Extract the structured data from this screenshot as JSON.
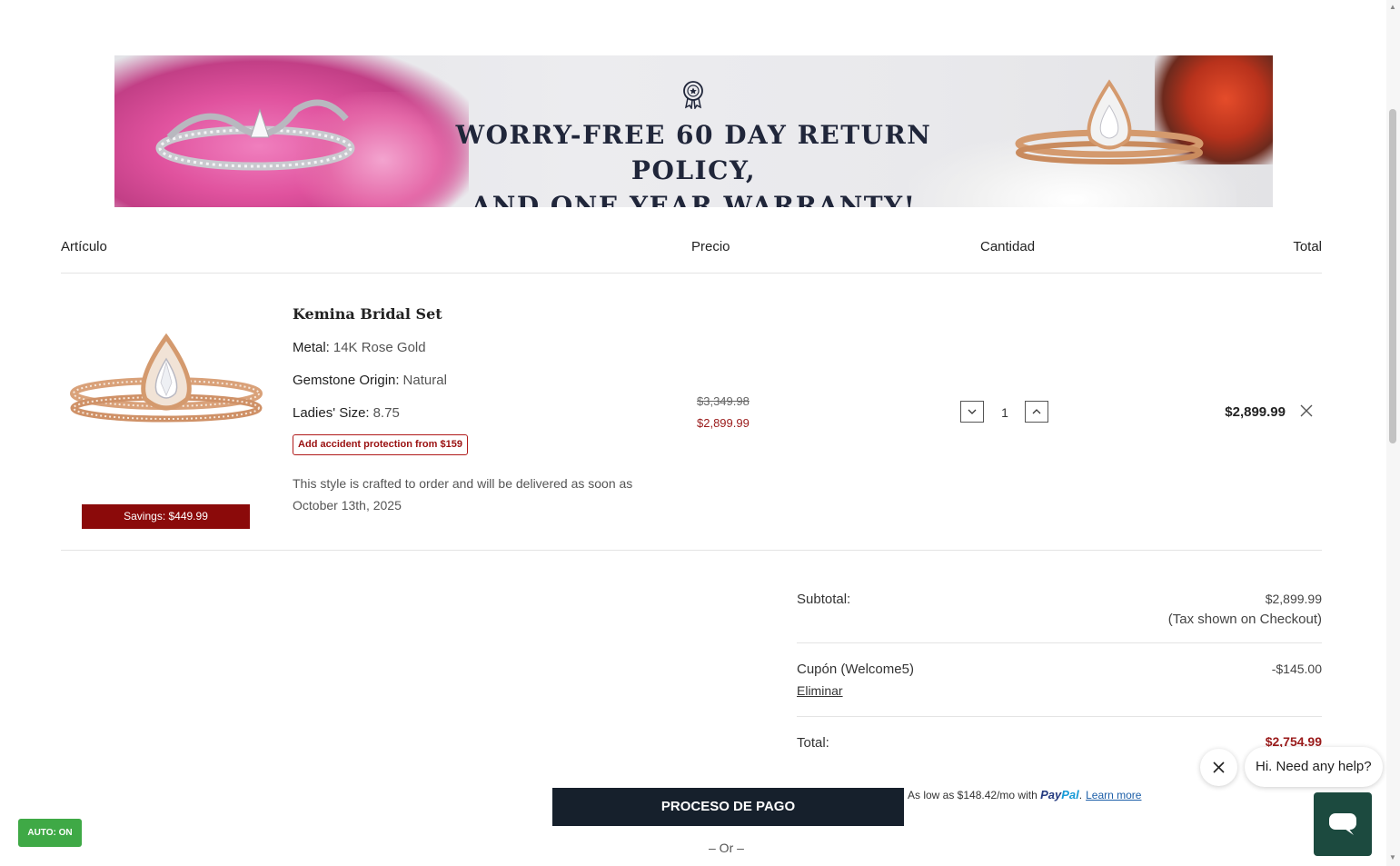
{
  "banner": {
    "line1": "WORRY-FREE 60 DAY RETURN POLICY,",
    "line2": "AND ONE YEAR WARRANTY!"
  },
  "table_header": {
    "item": "Artículo",
    "price": "Precio",
    "quantity": "Cantidad",
    "total": "Total"
  },
  "product": {
    "name": "Kemina Bridal Set",
    "attributes": [
      {
        "label": "Metal:",
        "value": "14K Rose Gold"
      },
      {
        "label": "Gemstone Origin:",
        "value": "Natural"
      },
      {
        "label": "Ladies' Size:",
        "value": "8.75"
      }
    ],
    "protection_label": "Add accident protection from $159",
    "delivery_note": "This style is crafted to order and will be delivered as soon as October 13th, 2025",
    "savings": "Savings: $449.99",
    "original_price": "$3,349.98",
    "sale_price": "$2,899.99",
    "quantity": "1",
    "line_total": "$2,899.99"
  },
  "summary": {
    "subtotal_label": "Subtotal:",
    "subtotal_value": "$2,899.99",
    "tax_note": "(Tax shown on Checkout)",
    "coupon_label": "Cupón (Welcome5)",
    "coupon_value": "-$145.00",
    "remove_coupon": "Eliminar",
    "total_label": "Total:",
    "total_value": "$2,754.99"
  },
  "checkout": {
    "button_label": "PROCESO DE PAGO",
    "paypal_text": "As low as $148.42/mo with",
    "paypal_brand_a": "Pay",
    "paypal_brand_b": "Pal",
    "paypal_learn": "Learn more",
    "or_text": "– Or –"
  },
  "chat": {
    "greeting": "Hi. Need any help?"
  },
  "auto_badge": "AUTO: ON",
  "colors": {
    "accent_red": "#9a1a1a",
    "savings_bg": "#8b0a0a",
    "checkout_bg": "#16202c",
    "chat_bg": "#1c4a3f",
    "auto_bg": "#3fa946"
  }
}
